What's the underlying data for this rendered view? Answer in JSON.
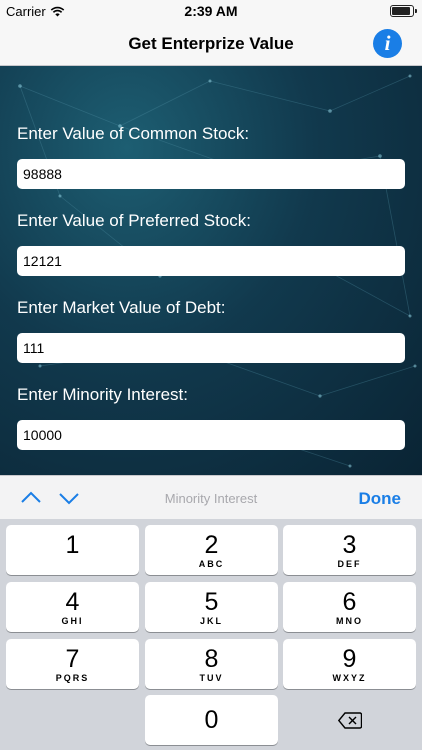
{
  "status_bar": {
    "carrier": "Carrier",
    "time": "2:39 AM"
  },
  "nav": {
    "title": "Get Enterprize Value",
    "info_icon": "info-icon"
  },
  "form": {
    "fields": [
      {
        "label": "Enter Value of Common Stock:",
        "value": "98888"
      },
      {
        "label": "Enter Value of Preferred Stock:",
        "value": "12121"
      },
      {
        "label": "Enter Market Value of Debt:",
        "value": "111"
      },
      {
        "label": "Enter Minority Interest:",
        "value": "10000"
      }
    ]
  },
  "keyboard_toolbar": {
    "placeholder": "Minority Interest",
    "done_label": "Done"
  },
  "keypad": {
    "keys": [
      {
        "num": "1",
        "letters": ""
      },
      {
        "num": "2",
        "letters": "ABC"
      },
      {
        "num": "3",
        "letters": "DEF"
      },
      {
        "num": "4",
        "letters": "GHI"
      },
      {
        "num": "5",
        "letters": "JKL"
      },
      {
        "num": "6",
        "letters": "MNO"
      },
      {
        "num": "7",
        "letters": "PQRS"
      },
      {
        "num": "8",
        "letters": "TUV"
      },
      {
        "num": "9",
        "letters": "WXYZ"
      },
      {
        "num": "0",
        "letters": ""
      }
    ]
  },
  "colors": {
    "accent": "#1a7ee6",
    "background": "#0c2f40",
    "keypad": "#d1d4da"
  }
}
